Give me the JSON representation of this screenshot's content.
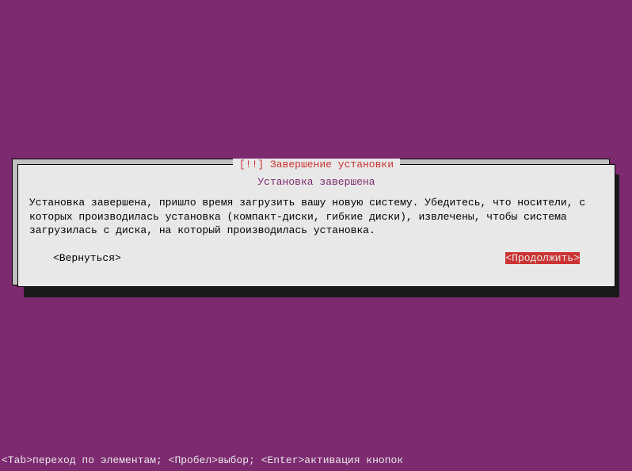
{
  "dialog": {
    "title": "[!!] Завершение установки",
    "subtitle": "Установка завершена",
    "message": "Установка завершена, пришло время загрузить вашу новую систему. Убедитесь, что носители, с которых производилась установка (компакт-диски, гибкие диски), извлечены, чтобы система загрузилась с диска, на который производилась установка.",
    "back_button": "<Вернуться>",
    "continue_button": "<Продолжить>"
  },
  "footer": {
    "tab_key": "<Tab>",
    "tab_text": "переход по элементам; ",
    "space_key": "<Пробел>",
    "space_text": "выбор; ",
    "enter_key": "<Enter>",
    "enter_text": "активация кнопок"
  }
}
